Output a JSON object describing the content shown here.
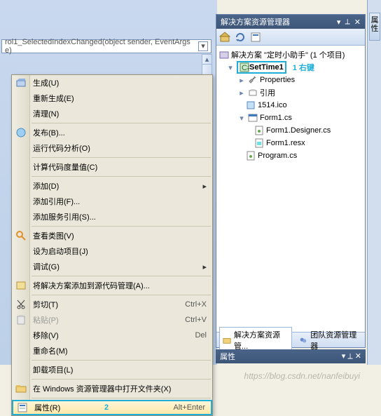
{
  "combo": {
    "text": "rol1_SelectedIndexChanged(object sender, EventArgs e)"
  },
  "rightStrip": {
    "label": "属性"
  },
  "panel": {
    "title": "解决方案资源管理器",
    "root": "解决方案 \"定时小助手\" (1 个项目)",
    "project": "SetTime1",
    "anno1": "1 右键",
    "nodes": {
      "properties": "Properties",
      "refs": "引用",
      "ico": "1514.ico",
      "form": "Form1.cs",
      "designer": "Form1.Designer.cs",
      "resx": "Form1.resx",
      "program": "Program.cs"
    },
    "tabs": {
      "a": "解决方案资源管...",
      "b": "团队资源管理器"
    }
  },
  "menu": {
    "build": "生成(U)",
    "rebuild": "重新生成(E)",
    "clean": "清理(N)",
    "publish": "发布(B)...",
    "codeAnalysis": "运行代码分析(O)",
    "codeMetrics": "计算代码度量值(C)",
    "add": "添加(D)",
    "addRef": "添加引用(F)...",
    "addService": "添加服务引用(S)...",
    "classView": "查看类图(V)",
    "startup": "设为启动项目(J)",
    "debug": "调试(G)",
    "addToSrc": "将解决方案添加到源代码管理(A)...",
    "cut": "剪切(T)",
    "cutSc": "Ctrl+X",
    "paste": "粘贴(P)",
    "pasteSc": "Ctrl+V",
    "remove": "移除(V)",
    "removeSc": "Del",
    "rename": "重命名(M)",
    "unload": "卸载项目(L)",
    "explorer": "在 Windows 资源管理器中打开文件夹(X)",
    "props": "属性(R)",
    "propsSc": "Alt+Enter",
    "anno2": "2"
  },
  "propBar": {
    "title": "属性"
  },
  "watermark": "https://blog.csdn.net/nanfeibuyi"
}
